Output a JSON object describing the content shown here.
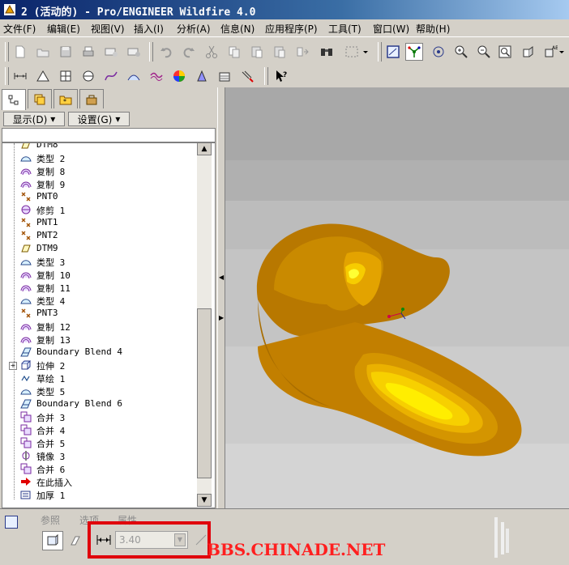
{
  "window": {
    "title": "2 (活动的) - Pro/ENGINEER Wildfire 4.0"
  },
  "menu": [
    "文件(F)",
    "编辑(E)",
    "视图(V)",
    "插入(I)",
    "分析(A)",
    "信息(N)",
    "应用程序(P)",
    "工具(T)",
    "窗口(W)",
    "帮助(H)"
  ],
  "panel": {
    "show_label": "显示(D)",
    "settings_label": "设置(G)",
    "tabs": [
      "model-tree-tab",
      "layer-tab",
      "favorites-tab",
      "tools-tab"
    ]
  },
  "tree": {
    "items": [
      {
        "label": "DTM8",
        "icon": "datum-plane-icon"
      },
      {
        "label": "类型 2",
        "icon": "surface-icon"
      },
      {
        "label": "复制 8",
        "icon": "copy-surface-icon"
      },
      {
        "label": "复制 9",
        "icon": "copy-surface-icon"
      },
      {
        "label": "PNT0",
        "icon": "datum-point-icon"
      },
      {
        "label": "修剪 1",
        "icon": "trim-icon"
      },
      {
        "label": "PNT1",
        "icon": "datum-point-icon"
      },
      {
        "label": "PNT2",
        "icon": "datum-point-icon"
      },
      {
        "label": "DTM9",
        "icon": "datum-plane-icon"
      },
      {
        "label": "类型 3",
        "icon": "surface-icon"
      },
      {
        "label": "复制 10",
        "icon": "copy-surface-icon"
      },
      {
        "label": "复制 11",
        "icon": "copy-surface-icon"
      },
      {
        "label": "类型 4",
        "icon": "surface-icon"
      },
      {
        "label": "PNT3",
        "icon": "datum-point-icon"
      },
      {
        "label": "复制 12",
        "icon": "copy-surface-icon"
      },
      {
        "label": "复制 13",
        "icon": "copy-surface-icon"
      },
      {
        "label": "Boundary Blend 4",
        "icon": "boundary-blend-icon"
      },
      {
        "label": "拉伸 2",
        "icon": "extrude-icon",
        "expandable": true
      },
      {
        "label": "草绘 1",
        "icon": "sketch-icon"
      },
      {
        "label": "类型 5",
        "icon": "surface-icon"
      },
      {
        "label": "Boundary Blend 6",
        "icon": "boundary-blend-icon"
      },
      {
        "label": "合并 3",
        "icon": "merge-icon"
      },
      {
        "label": "合并 4",
        "icon": "merge-icon"
      },
      {
        "label": "合并 5",
        "icon": "merge-icon"
      },
      {
        "label": "镜像 3",
        "icon": "mirror-icon"
      },
      {
        "label": "合并 6",
        "icon": "merge-icon"
      },
      {
        "label": "在此插入",
        "icon": "insert-here-arrow-icon"
      },
      {
        "label": "加厚 1",
        "icon": "thicken-icon"
      }
    ]
  },
  "dashboard": {
    "tabs": [
      "参照",
      "选项",
      "属性"
    ],
    "thickness_value": "3.40"
  },
  "watermark": "BBS.CHINADE.NET",
  "colors": {
    "title_bar": "#0a246a",
    "highlight_box": "#e0000c",
    "model_gold": "#c98a00",
    "watermark": "#ff1f1f"
  }
}
